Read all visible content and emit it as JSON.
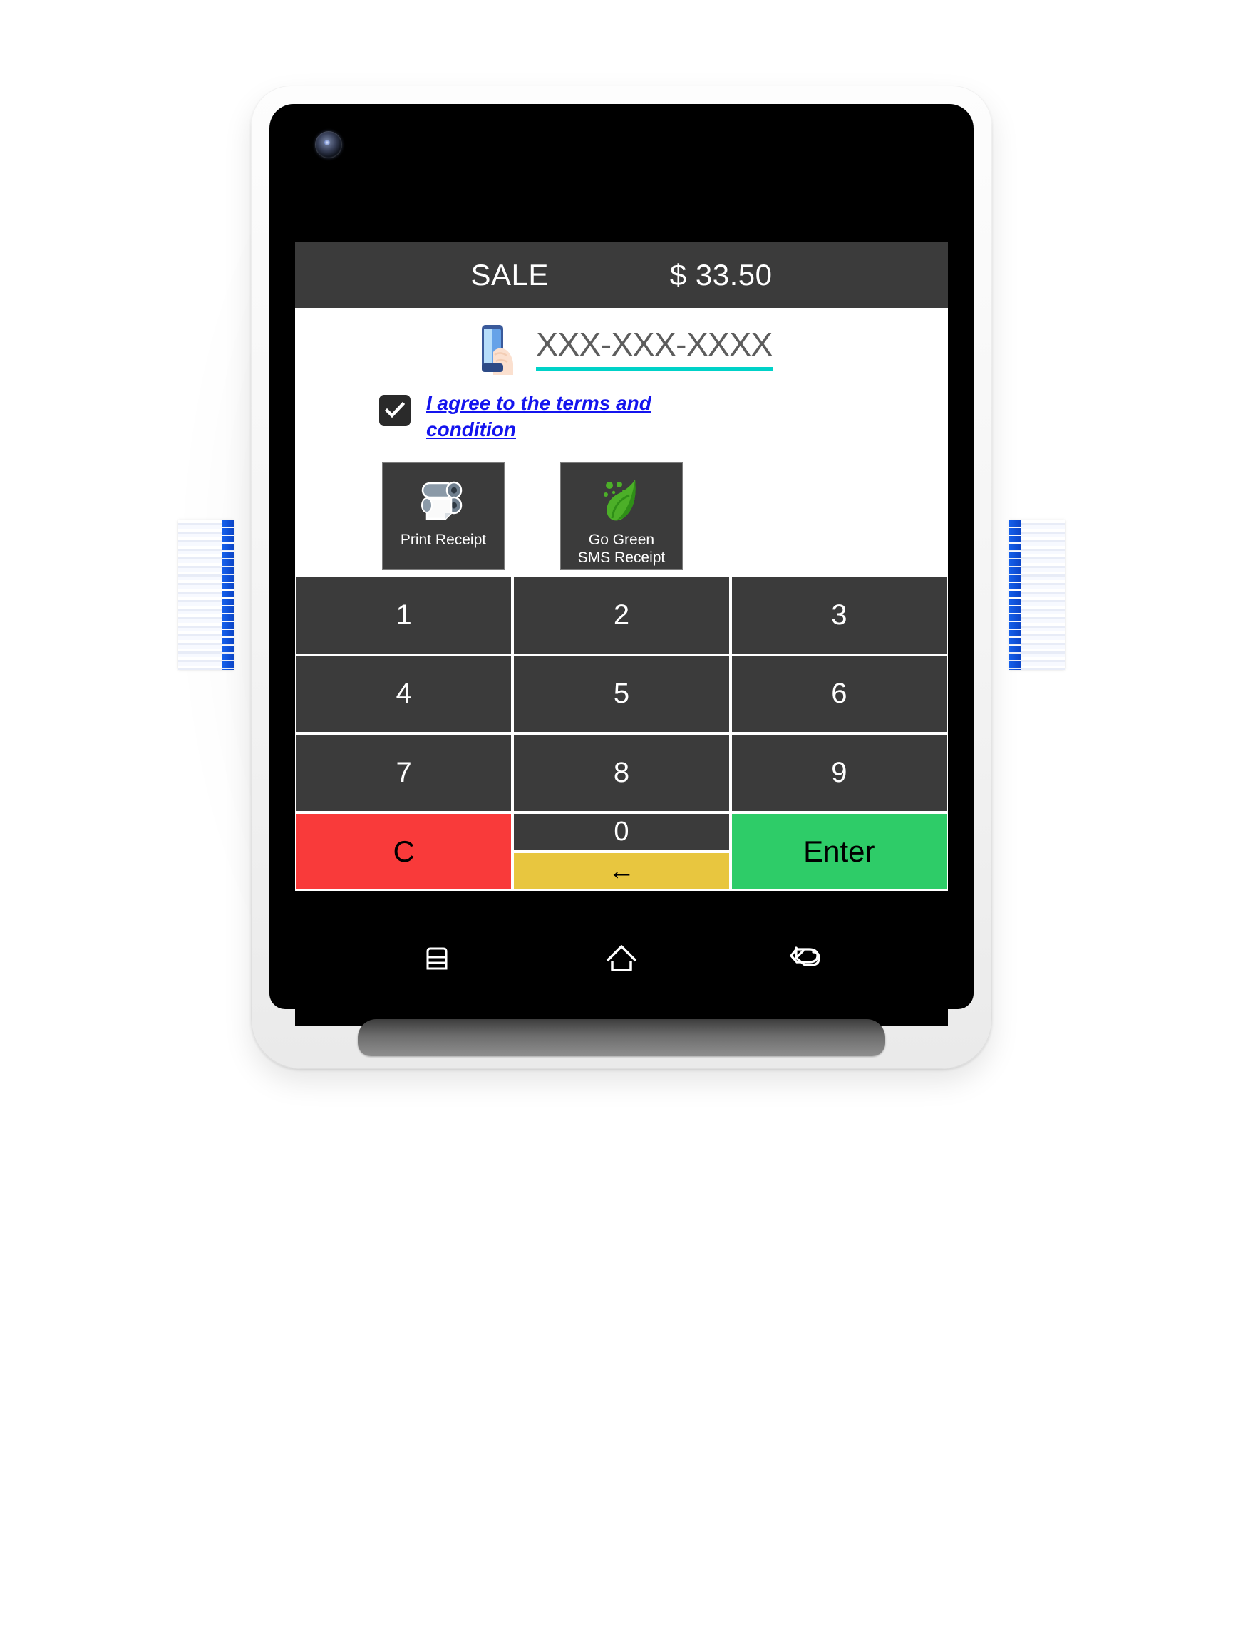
{
  "app": {
    "header": {
      "title": "SALE",
      "amount": "$ 33.50"
    },
    "phone_entry": {
      "icon": "mobile-phone-in-hand-icon",
      "placeholder": "XXX-XXX-XXXX",
      "value": "",
      "underline_color": "#00d2c8"
    },
    "terms": {
      "checked": true,
      "label": "I agree to the terms and condition",
      "link_color": "#1414ee"
    },
    "receipt_options": [
      {
        "id": "print-receipt",
        "label": "Print Receipt",
        "icon": "paper-roll-icon"
      },
      {
        "id": "go-green-sms-receipt",
        "label": "Go Green\nSMS Receipt",
        "icon": "green-leaf-icon"
      }
    ],
    "keypad": {
      "digits": [
        "1",
        "2",
        "3",
        "4",
        "5",
        "6",
        "7",
        "8",
        "9"
      ],
      "zero": "0",
      "clear": "C",
      "backspace": "←",
      "enter": "Enter",
      "colors": {
        "key": "#3b3b3b",
        "clear": "#f93a3a",
        "backspace": "#e8c63f",
        "enter": "#2ecc68"
      }
    }
  },
  "navbar": {
    "recent": "recent-apps-icon",
    "home": "home-icon",
    "back": "back-icon"
  }
}
